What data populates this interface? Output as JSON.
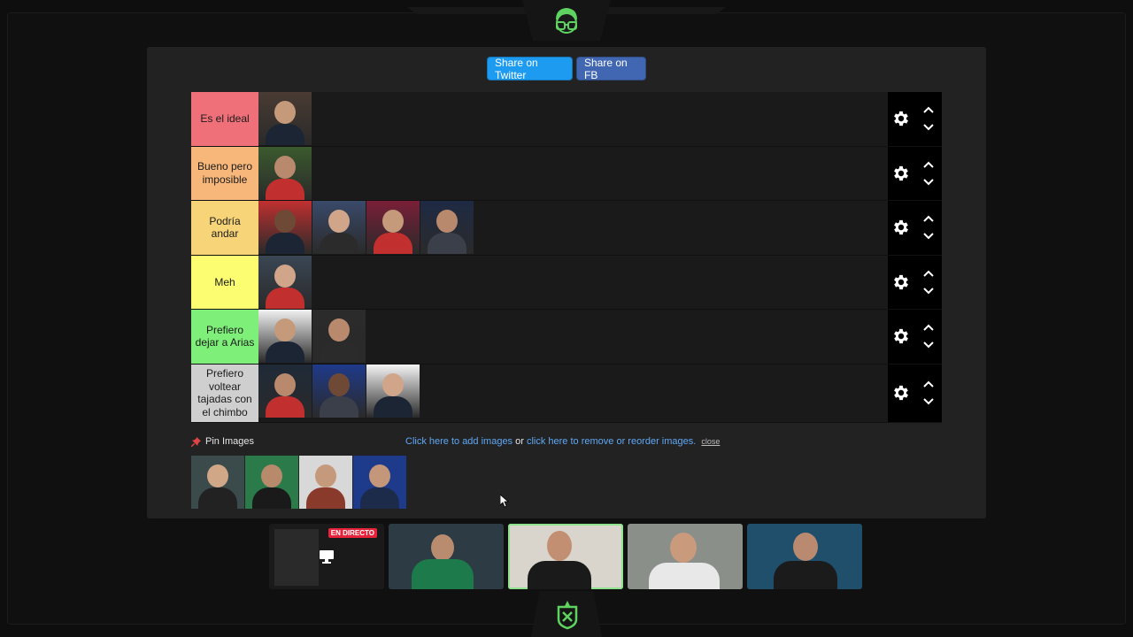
{
  "share": {
    "twitter_label": "Share on Twitter",
    "fb_label": "Share on FB"
  },
  "tiers": [
    {
      "label": "Es el ideal",
      "color": "#f0707a",
      "item_count": 1
    },
    {
      "label": "Bueno pero imposible",
      "color": "#f7b77a",
      "item_count": 1
    },
    {
      "label": "Podría andar",
      "color": "#f8d478",
      "item_count": 4
    },
    {
      "label": "Meh",
      "color": "#fdfd72",
      "item_count": 1
    },
    {
      "label": "Prefiero dejar a Arias",
      "color": "#7ef07a",
      "item_count": 2
    },
    {
      "label": "Prefiero voltear tajadas con el chimbo",
      "color": "#cfcfcf",
      "item_count": 3
    }
  ],
  "pin": {
    "label": "Pin Images",
    "add_link": "Click here to add images",
    "or_text": " or ",
    "remove_link": "click here to remove or reorder images.",
    "close": "close"
  },
  "live_badge": "EN DIRECTO",
  "icons": {
    "tier_settings": "gear-icon",
    "move_up": "chevron-up-icon",
    "move_down": "chevron-down-icon",
    "pin": "pin-icon",
    "logo": "glasses-logo-icon"
  },
  "colors": {
    "panel": "#222222",
    "twitter": "#1d9bf0",
    "facebook": "#4267b2",
    "link": "#5fa8f5",
    "accent_green": "#6ee06e"
  }
}
